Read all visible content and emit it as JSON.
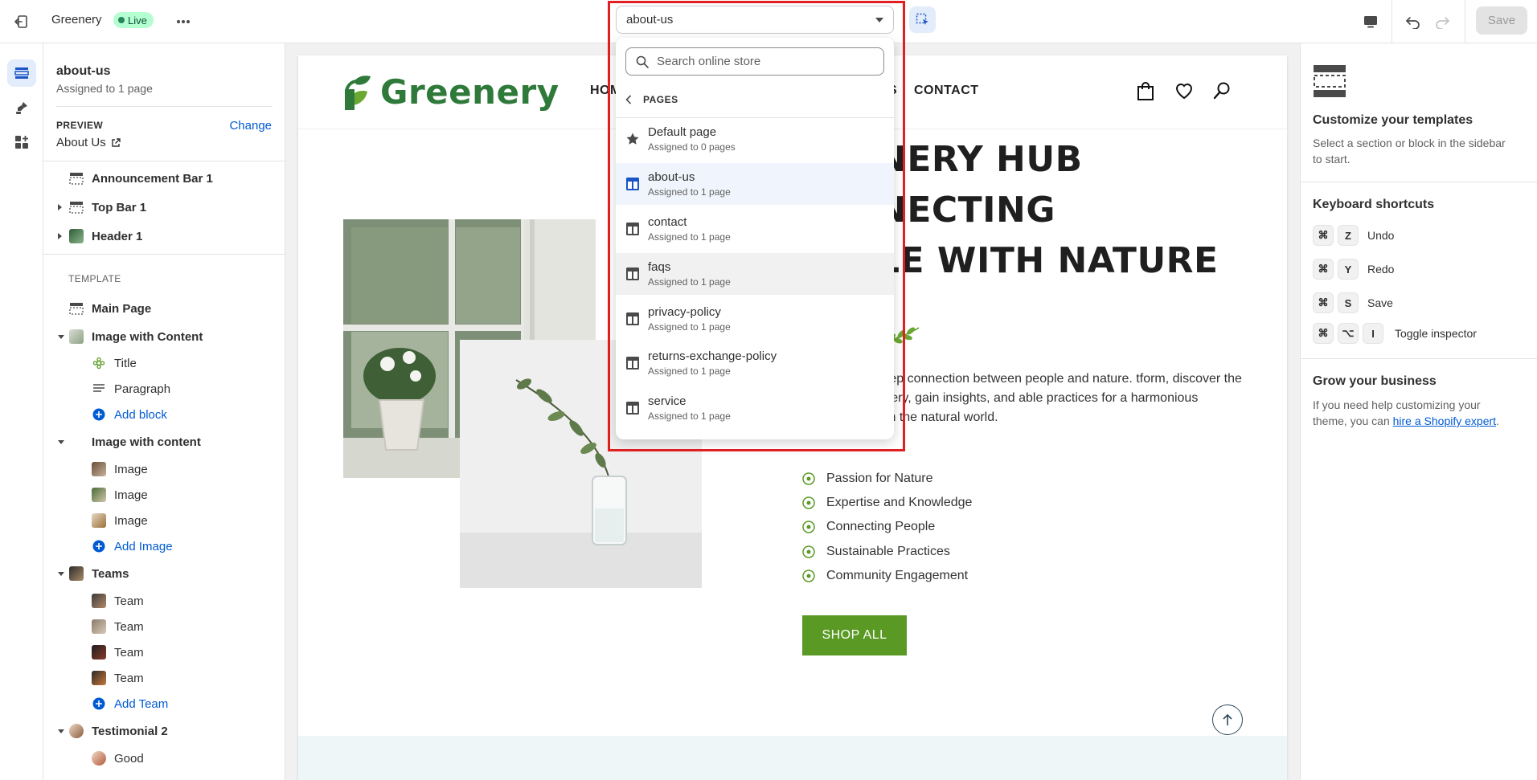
{
  "topbar": {
    "store_name": "Greenery",
    "live_label": "Live",
    "template_select": "about-us",
    "save_label": "Save"
  },
  "sidebar": {
    "title": "about-us",
    "subtitle": "Assigned to 1 page",
    "preview_label": "PREVIEW",
    "change_label": "Change",
    "preview_value": "About Us",
    "header_items": [
      {
        "label": "Announcement Bar 1"
      },
      {
        "label": "Top Bar 1"
      },
      {
        "label": "Header 1"
      }
    ],
    "template_label": "TEMPLATE",
    "main_page": "Main Page",
    "image_with_content_1": {
      "label": "Image with Content",
      "children": [
        "Title",
        "Paragraph"
      ],
      "add": "Add block"
    },
    "image_with_content_2": {
      "label": "Image with content",
      "children": [
        "Image",
        "Image",
        "Image"
      ],
      "add": "Add Image"
    },
    "teams": {
      "label": "Teams",
      "children": [
        "Team",
        "Team",
        "Team",
        "Team"
      ],
      "add": "Add Team"
    },
    "testimonial": {
      "label": "Testimonial 2",
      "children": [
        "Good"
      ]
    }
  },
  "dropdown": {
    "search_placeholder": "Search online store",
    "back_label": "PAGES",
    "items": [
      {
        "title": "Default page",
        "sub": "Assigned to 0 pages",
        "icon": "star-icon"
      },
      {
        "title": "about-us",
        "sub": "Assigned to 1 page",
        "icon": "template-icon"
      },
      {
        "title": "contact",
        "sub": "Assigned to 1 page",
        "icon": "template-icon"
      },
      {
        "title": "faqs",
        "sub": "Assigned to 1 page",
        "icon": "template-icon"
      },
      {
        "title": "privacy-policy",
        "sub": "Assigned to 1 page",
        "icon": "template-icon"
      },
      {
        "title": "returns-exchange-policy",
        "sub": "Assigned to 1 page",
        "icon": "template-icon"
      },
      {
        "title": "service",
        "sub": "Assigned to 1 page",
        "icon": "template-icon"
      }
    ]
  },
  "preview": {
    "logo": "Greenery",
    "nav_home": "HOM",
    "nav_partial": "S",
    "nav_contact": "CONTACT",
    "heading_lines": [
      "NERY HUB",
      "NECTING",
      "LE WITH NATURE"
    ],
    "paragraph": ", we foster a deep connection between people and nature. tform, discover the beauty of greenery, gain insights, and able practices for a harmonious coexistence with the natural world.",
    "features": [
      "Passion for Nature",
      "Expertise and Knowledge",
      "Connecting People",
      "Sustainable Practices",
      "Community Engagement"
    ],
    "shop_label": "SHOP ALL"
  },
  "rightpanel": {
    "customize_title": "Customize your templates",
    "customize_text": "Select a section or block in the sidebar to start.",
    "shortcuts_title": "Keyboard shortcuts",
    "shortcuts": [
      {
        "keys": [
          "⌘",
          "Z"
        ],
        "label": "Undo"
      },
      {
        "keys": [
          "⌘",
          "Y"
        ],
        "label": "Redo"
      },
      {
        "keys": [
          "⌘",
          "S"
        ],
        "label": "Save"
      },
      {
        "keys": [
          "⌘",
          "⌥",
          "I"
        ],
        "label": "Toggle inspector"
      }
    ],
    "grow_title": "Grow your business",
    "grow_text": "If you need help customizing your theme, you can ",
    "grow_link": "hire a Shopify expert",
    "grow_end": "."
  },
  "colors": {
    "accent": "#005bd3",
    "live_bg": "#b4fed2",
    "brand_green": "#5a9a24",
    "highlight": "#e02020"
  }
}
